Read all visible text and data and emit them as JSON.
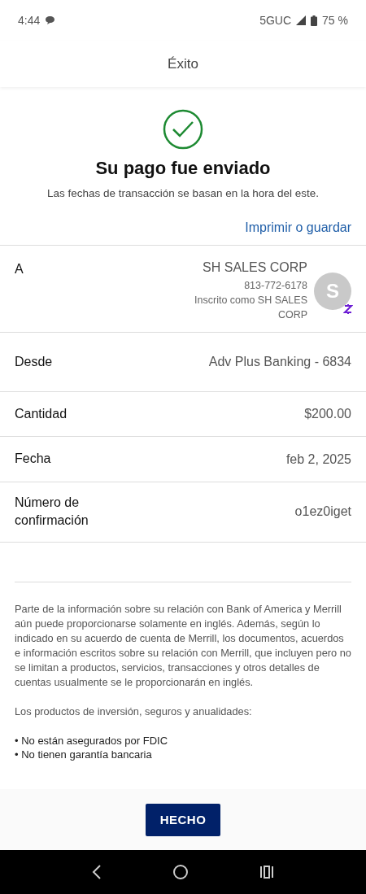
{
  "status_bar": {
    "time": "4:44",
    "network": "5GUC",
    "battery": "75 %"
  },
  "header": {
    "title": "Éxito"
  },
  "confirmation": {
    "title": "Su pago fue enviado",
    "subtitle": "Las fechas de transacción se basan en la hora del este.",
    "print_link": "Imprimir o guardar"
  },
  "details": [
    {
      "kind": "payee",
      "label": "A",
      "name": "SH SALES CORP",
      "phone": "813-772-6178",
      "enrolled_as": "Inscrito como SH SALES CORP",
      "avatar_letter": "S"
    },
    {
      "kind": "plain",
      "label": "Desde",
      "value": "Adv Plus Banking - 6834"
    },
    {
      "kind": "plain",
      "label": "Cantidad",
      "value": "$200.00"
    },
    {
      "kind": "plain",
      "label": "Fecha",
      "value": "feb 2, 2025"
    },
    {
      "kind": "plain",
      "label": "Número de confirmación",
      "value": "o1ez0iget"
    }
  ],
  "disclaimer": {
    "paragraph": "Parte de la información sobre su relación con Bank of America y Merrill aún puede proporcionarse solamente en inglés. Además, según lo indicado en su acuerdo de cuenta de Merrill, los documentos, acuerdos e información escritos sobre su relación con Merrill, que incluyen pero no se limitan a productos, servicios, transacciones y otros detalles de cuentas usualmente se le proporcionarán en inglés.",
    "intro": "Los productos de inversión, seguros y anualidades:",
    "bullets": [
      "• No están asegurados por FDIC",
      "• No tienen garantía bancaria"
    ]
  },
  "footer": {
    "button": "HECHO"
  }
}
